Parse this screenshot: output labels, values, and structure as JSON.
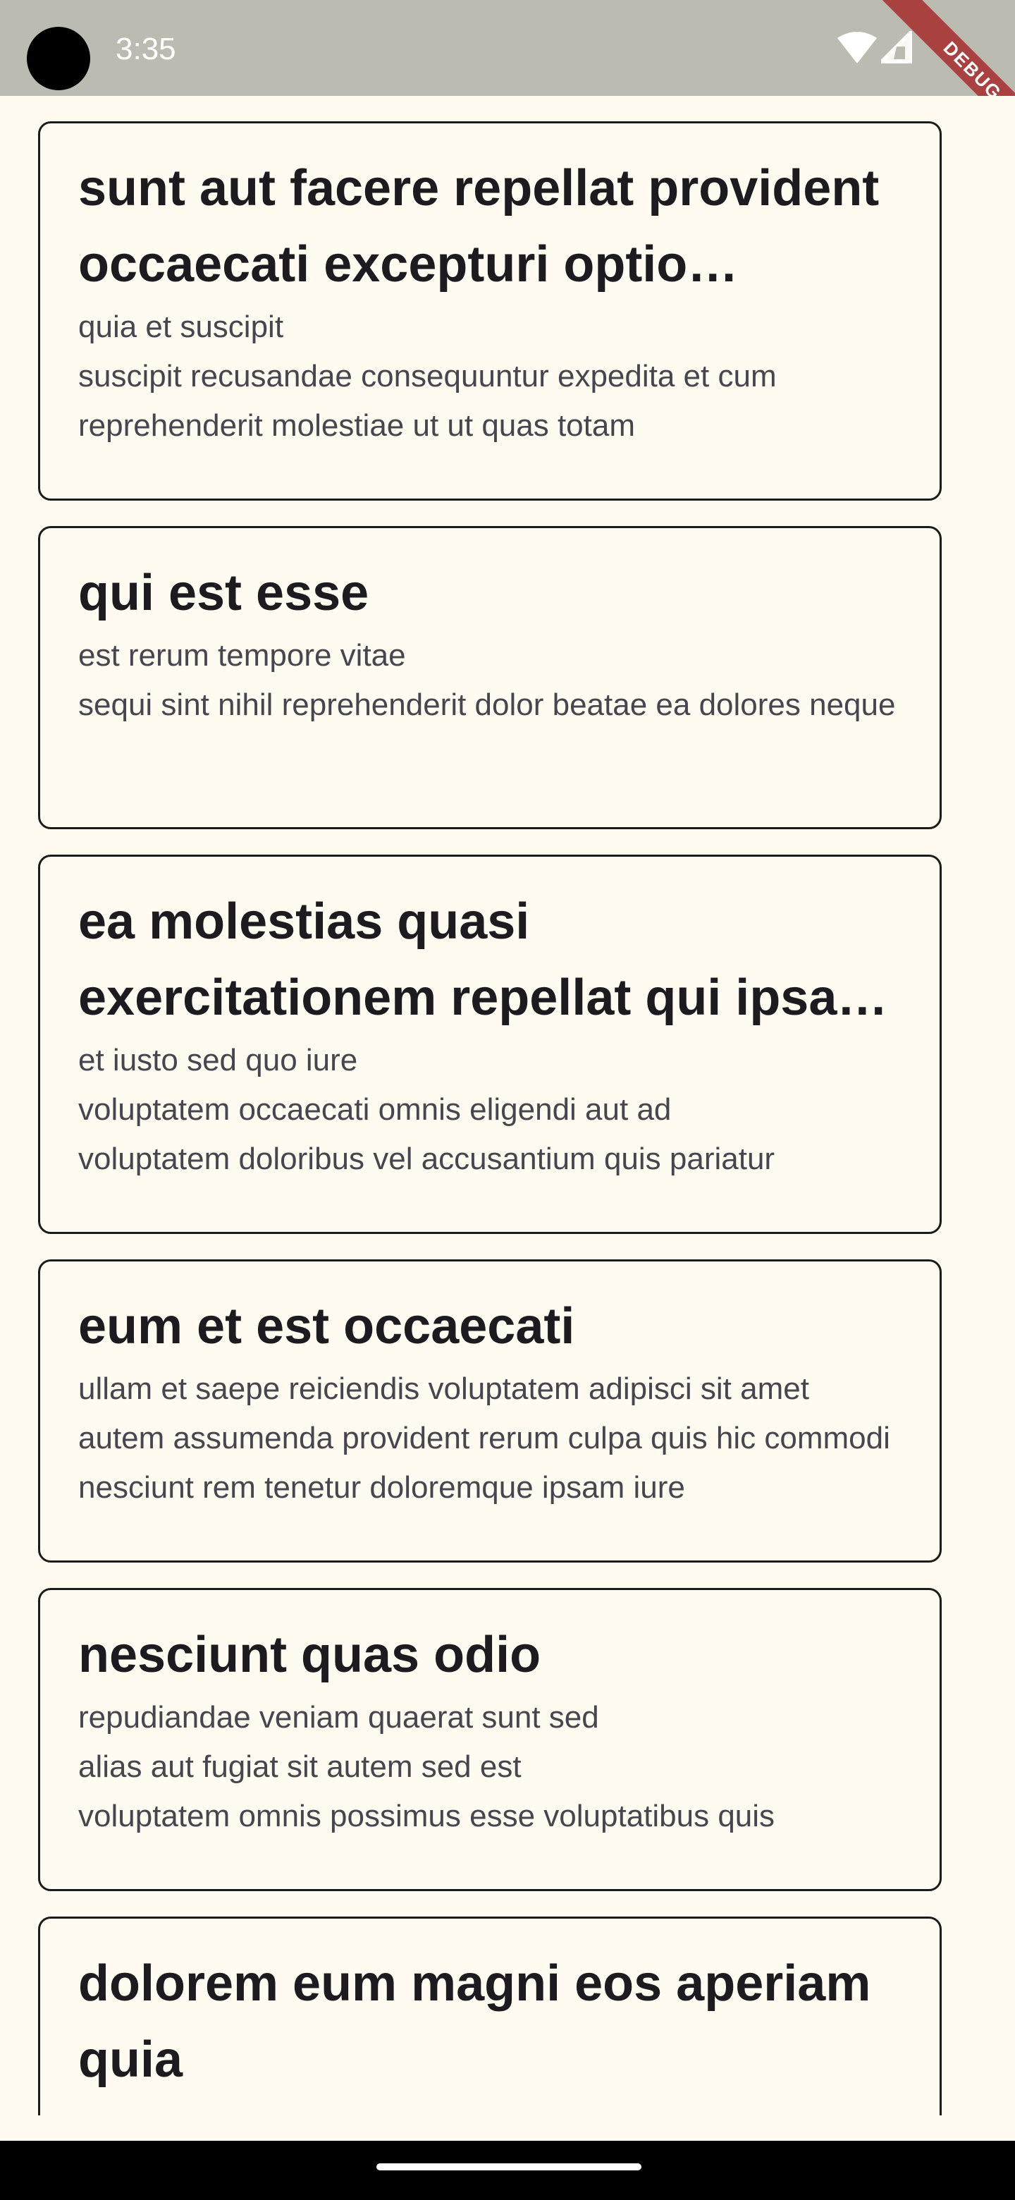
{
  "status_bar": {
    "time": "3:35",
    "debug_label": "DEBUG"
  },
  "posts": [
    {
      "title": "sunt aut facere repellat provident occaecati excepturi optio reprehenderit",
      "body": "quia et suscipit\nsuscipit recusandae consequuntur expedita et cum\nreprehenderit molestiae ut ut quas totam"
    },
    {
      "title": "qui est esse",
      "body": "est rerum tempore vitae\nsequi sint nihil reprehenderit dolor beatae ea dolores neque"
    },
    {
      "title": "ea molestias quasi exercitationem repellat qui ipsa sit aut",
      "body": "et iusto sed quo iure\nvoluptatem occaecati omnis eligendi aut ad\nvoluptatem doloribus vel accusantium quis pariatur"
    },
    {
      "title": "eum et est occaecati",
      "body": "ullam et saepe reiciendis voluptatem adipisci\nsit amet autem assumenda provident rerum culpa\nquis hic commodi nesciunt rem tenetur doloremque ipsam iure"
    },
    {
      "title": "nesciunt quas odio",
      "body": "repudiandae veniam quaerat sunt sed\nalias aut fugiat sit autem sed est\nvoluptatem omnis possimus esse voluptatibus quis"
    },
    {
      "title": "dolorem eum magni eos aperiam quia",
      "body": ""
    }
  ]
}
